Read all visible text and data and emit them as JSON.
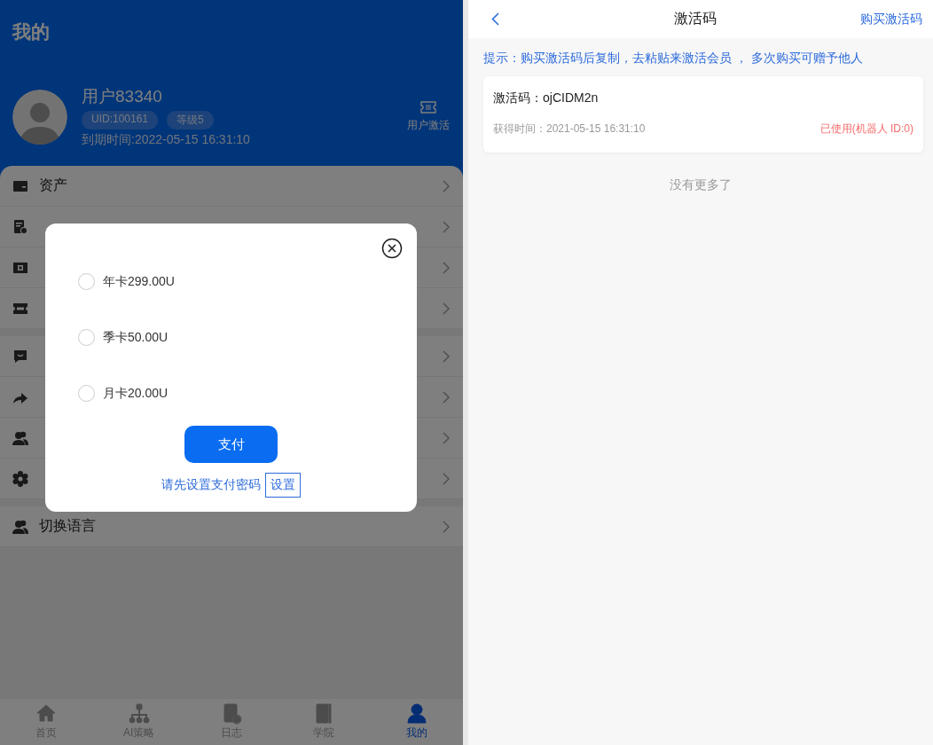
{
  "me_page": {
    "title": "我的",
    "user": {
      "name": "用户83340",
      "badges": [
        "UID:100161",
        "等级5"
      ],
      "expiry": "到期时间:2022-05-15 16:31:10"
    },
    "activate": {
      "label": "用户激活"
    },
    "menu": [
      [
        {
          "kind": "row",
          "label": "资产"
        },
        {
          "kind": "covered"
        },
        {
          "kind": "covered"
        },
        {
          "kind": "covered"
        }
      ],
      [
        {
          "kind": "covered"
        },
        {
          "kind": "covered"
        },
        {
          "kind": "covered"
        },
        {
          "kind": "covered"
        }
      ],
      [
        {
          "kind": "row",
          "label": "切换语言"
        }
      ]
    ],
    "nav": [
      {
        "label": "首页",
        "selected": false
      },
      {
        "label": "AI策略",
        "selected": false
      },
      {
        "label": "日志",
        "selected": false
      },
      {
        "label": "学院",
        "selected": false
      },
      {
        "label": "我的",
        "selected": true
      }
    ]
  },
  "pay_dialog": {
    "options": [
      {
        "label": "年卡299.00U",
        "selected": false
      },
      {
        "label": "季卡50.00U",
        "selected": false
      },
      {
        "label": "月卡20.00U",
        "selected": false
      }
    ],
    "pay_button": "支付",
    "hint": "请先设置支付密码",
    "set_button": "设置"
  },
  "code_page": {
    "title": "激活码",
    "action": "购买激活码",
    "tip": "提示：购买激活码后复制，去粘贴来激活会员 ， 多次购买可赠予他人",
    "codes": [
      {
        "code": "激活码：ojCIDM2n",
        "time": "获得时间：2021-05-15 16:31:10",
        "status": "已使用(机器人 ID:0)"
      }
    ],
    "end_note": "没有更多了"
  }
}
